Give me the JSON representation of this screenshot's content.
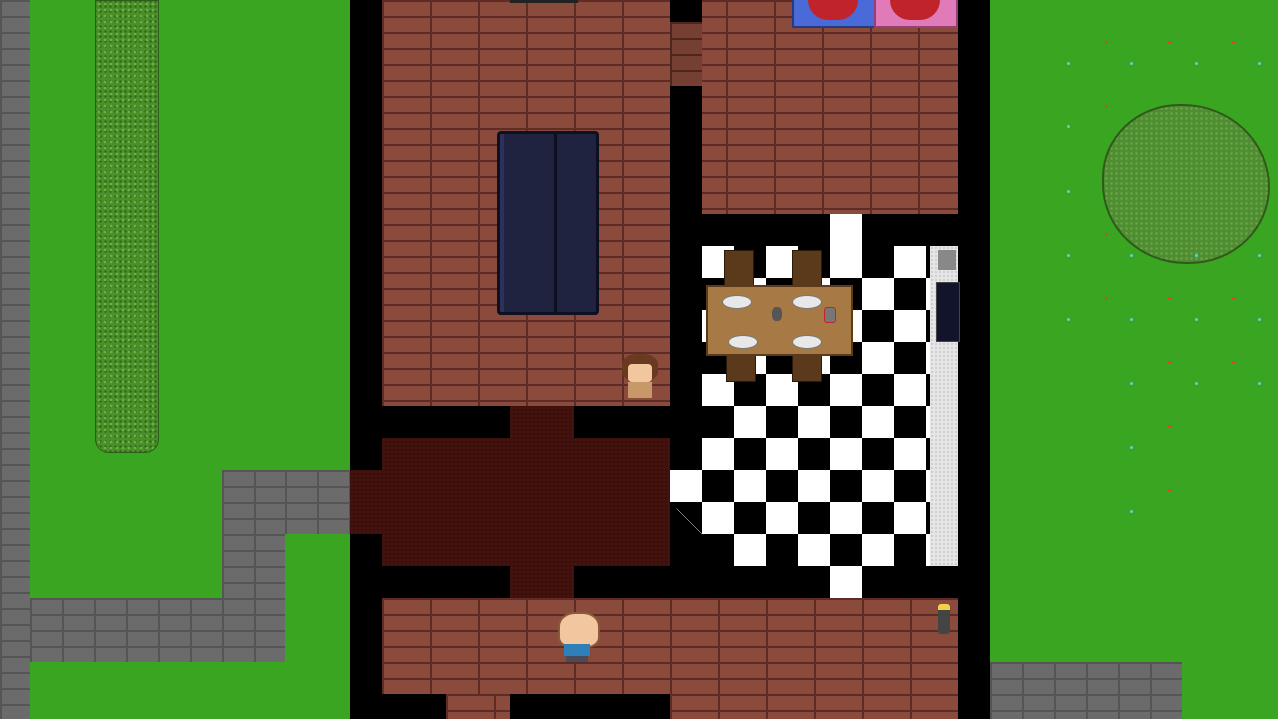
{
  "scene": {
    "type": "top-down house interior",
    "rooms": [
      "living-room",
      "bedroom",
      "hallway",
      "kitchen-dining",
      "lower-hall"
    ],
    "objects": [
      "sofa",
      "dining-table",
      "chairs",
      "bed",
      "bush",
      "hedge",
      "stone-path"
    ]
  },
  "colors": {
    "grass": "#3aa521",
    "wall": "#000000",
    "wood_floor": "#8a4a3c",
    "carpet": "#3b0f0b",
    "sofa": "#1f2340",
    "bush": "#4e8d31"
  },
  "characters": [
    {
      "name": "brown-haired-npc",
      "room": "living-room"
    },
    {
      "name": "bald-player",
      "room": "lower-hall"
    }
  ]
}
